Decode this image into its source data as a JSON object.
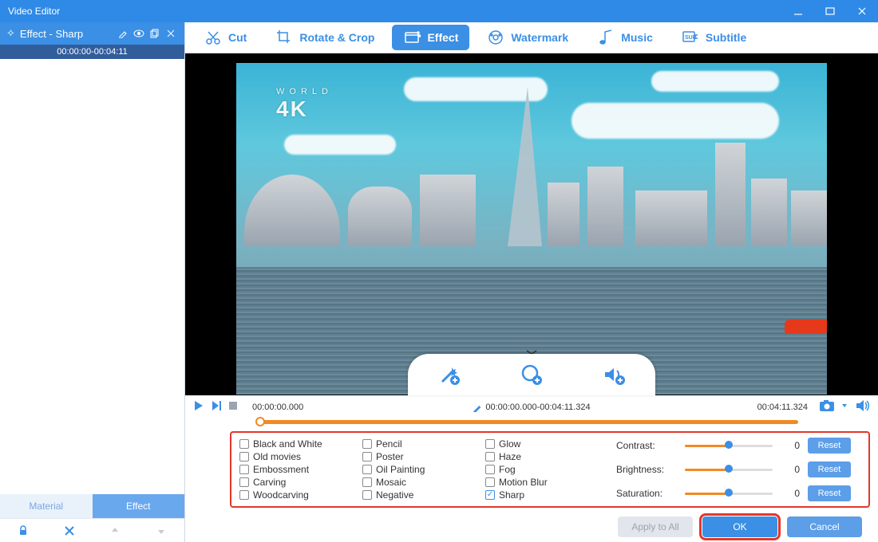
{
  "window": {
    "title": "Video Editor"
  },
  "sidebar": {
    "header_icon": "✧",
    "header": "Effect - Sharp",
    "clip_range": "00:00:00-00:04:11",
    "tabs": {
      "material": "Material",
      "effect": "Effect"
    }
  },
  "toolbar": {
    "cut": "Cut",
    "rotate": "Rotate & Crop",
    "effect": "Effect",
    "watermark": "Watermark",
    "music": "Music",
    "subtitle": "Subtitle"
  },
  "preview": {
    "watermark_top": "WORLD",
    "watermark_big": "4K"
  },
  "timeline": {
    "start": "00:00:00.000",
    "range": "00:00:00.000-00:04:11.324",
    "end": "00:04:11.324"
  },
  "effects": {
    "col1": [
      "Black and White",
      "Old movies",
      "Embossment",
      "Carving",
      "Woodcarving"
    ],
    "col2": [
      "Pencil",
      "Poster",
      "Oil Painting",
      "Mosaic",
      "Negative"
    ],
    "col3": [
      "Glow",
      "Haze",
      "Fog",
      "Motion Blur",
      "Sharp"
    ],
    "checked": "Sharp"
  },
  "sliders": {
    "rows": [
      {
        "label": "Contrast:",
        "value": "0",
        "reset": "Reset"
      },
      {
        "label": "Brightness:",
        "value": "0",
        "reset": "Reset"
      },
      {
        "label": "Saturation:",
        "value": "0",
        "reset": "Reset"
      }
    ]
  },
  "dialog": {
    "apply": "Apply to All",
    "ok": "OK",
    "cancel": "Cancel"
  }
}
